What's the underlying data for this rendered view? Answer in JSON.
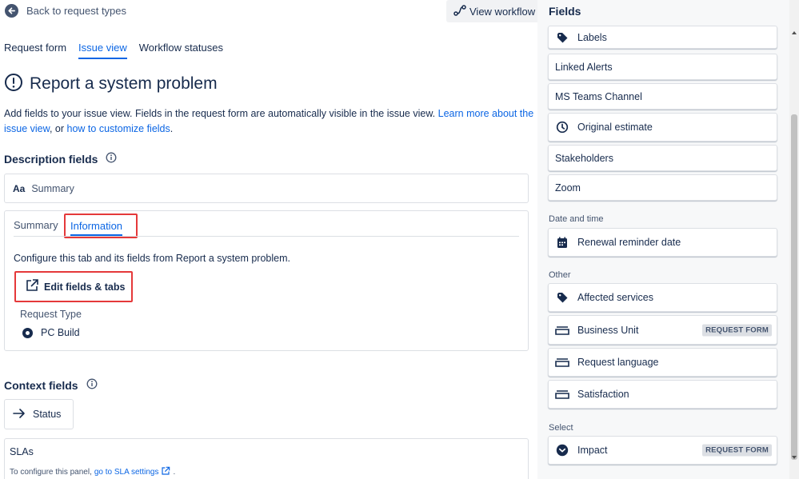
{
  "header": {
    "back_label": "Back to request types",
    "view_workflow_label": "View workflow"
  },
  "tabs": [
    {
      "label": "Request form",
      "active": false
    },
    {
      "label": "Issue view",
      "active": true
    },
    {
      "label": "Workflow statuses",
      "active": false
    }
  ],
  "page": {
    "title": "Report a system problem",
    "intro_text": "Add fields to your issue view. Fields in the request form are automatically visible in the issue view.",
    "learn_more_link": "Learn more about the issue view",
    "intro_or": ", or",
    "customize_link": "how to customize fields",
    "intro_end": "."
  },
  "description_fields": {
    "heading": "Description fields",
    "summary_field": "Summary",
    "summary_icon_text": "Aa",
    "panel": {
      "tabs": [
        "Summary",
        "Information"
      ],
      "active_tab": "Information",
      "description": "Configure this tab and its fields from Report a system problem.",
      "edit_button": "Edit fields & tabs",
      "request_type_label": "Request Type",
      "request_type_value": "PC Build"
    }
  },
  "context_fields": {
    "heading": "Context fields",
    "status_label": "Status",
    "slas": {
      "title": "SLAs",
      "desc": "To configure this panel,",
      "link": "go to SLA settings",
      "end": "."
    }
  },
  "sidebar": {
    "title": "Fields",
    "fields": [
      {
        "label": "Labels",
        "icon": "tag-icon"
      },
      {
        "label": "Linked Alerts",
        "icon": ""
      },
      {
        "label": "MS Teams Channel",
        "icon": ""
      },
      {
        "label": "Original estimate",
        "icon": "clock-icon"
      },
      {
        "label": "Stakeholders",
        "icon": ""
      },
      {
        "label": "Zoom",
        "icon": ""
      }
    ],
    "date_group": "Date and time",
    "date_fields": [
      {
        "label": "Renewal reminder date",
        "icon": "calendar-icon"
      }
    ],
    "other_group": "Other",
    "other_fields": [
      {
        "label": "Affected services",
        "icon": "tag-icon",
        "badge": ""
      },
      {
        "label": "Business Unit",
        "icon": "textfield-icon",
        "badge": "REQUEST FORM"
      },
      {
        "label": "Request language",
        "icon": "textfield-icon",
        "badge": ""
      },
      {
        "label": "Satisfaction",
        "icon": "textfield-icon",
        "badge": ""
      }
    ],
    "select_group": "Select",
    "select_fields": [
      {
        "label": "Impact",
        "icon": "chevron-circle-icon",
        "badge": "REQUEST FORM"
      }
    ]
  },
  "colors": {
    "accent": "#0c66e4",
    "highlight": "#e5393a",
    "text": "#172b4d",
    "subtle": "#44546f"
  }
}
